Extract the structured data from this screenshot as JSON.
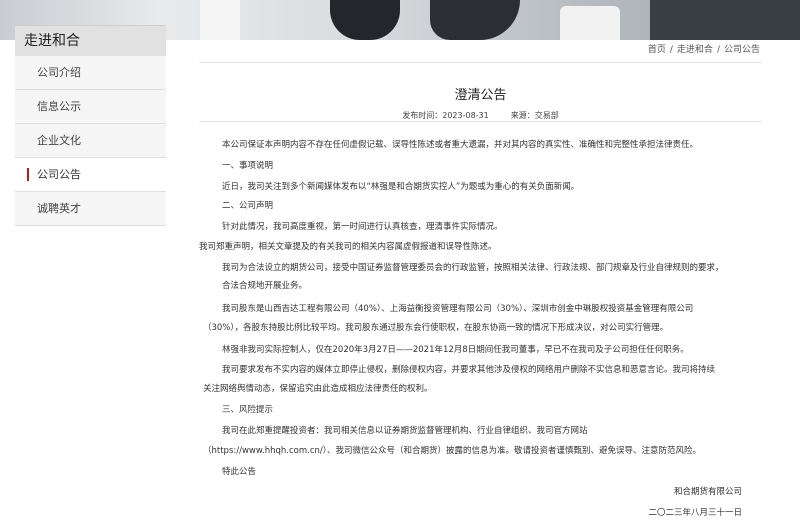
{
  "sidebar": {
    "title": "走进和合",
    "items": [
      {
        "label": "公司介绍"
      },
      {
        "label": "信息公示"
      },
      {
        "label": "企业文化"
      },
      {
        "label": "公司公告"
      },
      {
        "label": "诚聘英才"
      }
    ],
    "active_index": 3
  },
  "breadcrumb": {
    "home": "首页",
    "sep": "/",
    "section": "走进和合",
    "current": "公司公告"
  },
  "article": {
    "title": "澄清公告",
    "publish_time": "发布时间：2023-08-31",
    "source": "来源：交易部",
    "paragraphs": [
      "本公司保证本声明内容不存在任何虚假记载、误导性陈述或者重大遗漏，并对其内容的真实性、准确性和完整性承担法律责任。",
      "一、事项说明",
      "近日，我司关注到多个新闻媒体发布以“林强是和合期货实控人”为题或为重心的有关负面新闻。",
      "二、公司声明",
      "针对此情况，我司高度重视，第一时间进行认真核查，理清事件实际情况。",
      "我司郑重声明，相关文章提及的有关我司的相关内容属虚假报道和误导性陈述。",
      "我司为合法设立的期货公司，接受中国证券监督管理委员会的行政监管，按照相关法律、行政法规、部门规章及行业自律规则的要求，合法合规地开展业务。",
      "我司股东是山西吉达工程有限公司（40%）、上海益衡投资管理有限公司（30%）、深圳市创金中琳股权投资基金管理有限公司（30%），各股东持股比例比较平均。我司股东通过股东会行使职权，在股东协商一致的情况下形成决议，对公司实行管理。",
      "林强非我司实际控制人，仅在2020年3月27日——2021年12月8日期间任我司董事，早已不在我司及子公司担任任何职务。",
      "我司要求发布不实内容的媒体立即停止侵权，删除侵权内容，并要求其他涉及侵权的网络用户删除不实信息和恶意言论。我司将持续关注网络舆情动态，保留追究由此造成相应法律责任的权利。",
      "三、风险提示",
      "我司在此郑重提醒投资者：我司相关信息以证券期货监督管理机构、行业自律组织、我司官方网站（https://www.hhqh.com.cn/）、我司微信公众号（和合期货）披露的信息为准。敬请投资者谨慎甄别、避免误导、注意防范风险。",
      "特此公告"
    ],
    "lines": [
      "本公司保证本声明内容不存在任何虚假记载、误导性陈述或者重大遗漏，并对其内容的真实性、准确性和完整性承担法律责任。",
      "一、事项说明",
      "近日，我司关注到多个新闻媒体发布以“林强是和合期货实控人”为题或为重心的有关负面新闻。",
      "二、公司声明",
      "针对此情况，我司高度重视，第一时间进行认真核查，理清事件实际情况。",
      "我司郑重声明，相关文章提及的有关我司的相关内容属虚假报道和误导性陈述。",
      "我司为合法设立的期货公司，接受中国证券监督管理委员会的行政监管，按照相关法律、行政法规、部门规章及行业自律规则的要求，",
      "合法合规地开展业务。",
      "我司股东是山西吉达工程有限公司（40%）、上海益衡投资管理有限公司（30%）、深圳市创金中琳股权投资基金管理有限公司",
      "（30%），各股东持股比例比较平均。我司股东通过股东会行使职权，在股东协商一致的情况下形成决议，对公司实行管理。",
      "林强非我司实际控制人，仅在2020年3月27日——2021年12月8日期间任我司董事，早已不在我司及子公司担任任何职务。",
      "我司要求发布不实内容的媒体立即停止侵权，删除侵权内容，并要求其他涉及侵权的网络用户删除不实信息和恶意言论。我司将持续",
      "关注网络舆情动态，保留追究由此造成相应法律责任的权利。",
      "三、风险提示",
      "我司在此郑重提醒投资者：我司相关信息以证券期货监督管理机构、行业自律组织、我司官方网站",
      "（https://www.hhqh.com.cn/）、我司微信公众号（和合期货）披露的信息为准。敬请投资者谨慎甄别、避免误导、注意防范风险。",
      "特此公告"
    ],
    "signature": "和合期货有限公司",
    "date": "二〇二三年八月三十一日"
  }
}
